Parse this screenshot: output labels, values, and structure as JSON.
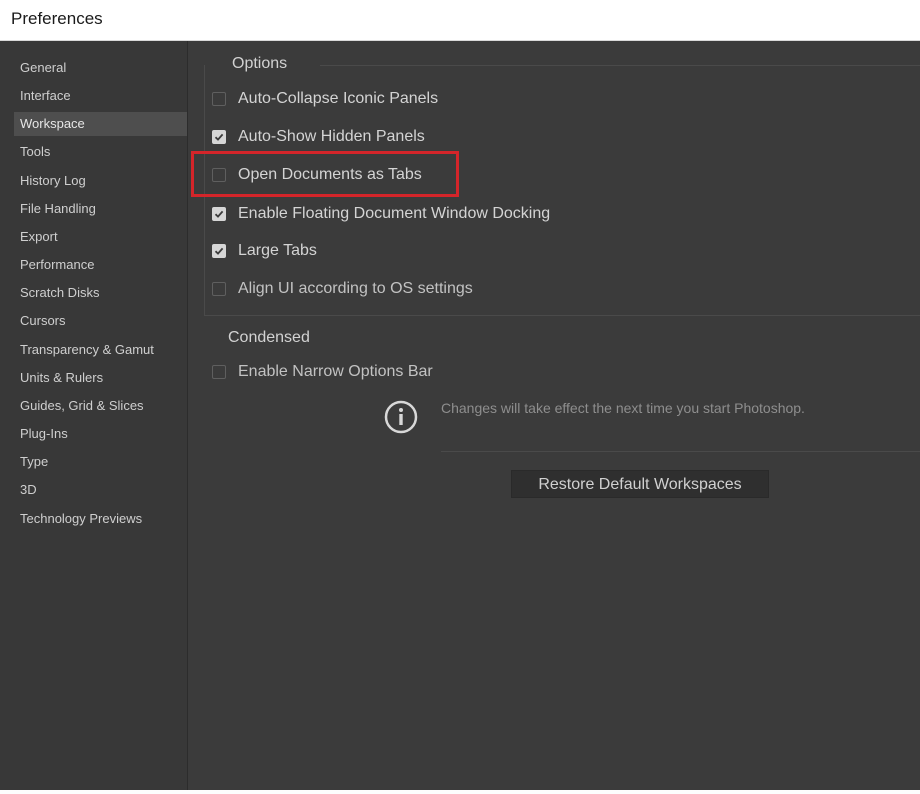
{
  "window": {
    "title": "Preferences"
  },
  "sidebar": {
    "items": [
      {
        "label": "General"
      },
      {
        "label": "Interface"
      },
      {
        "label": "Workspace",
        "selected": true
      },
      {
        "label": "Tools"
      },
      {
        "label": "History Log"
      },
      {
        "label": "File Handling"
      },
      {
        "label": "Export"
      },
      {
        "label": "Performance"
      },
      {
        "label": "Scratch Disks"
      },
      {
        "label": "Cursors"
      },
      {
        "label": "Transparency & Gamut"
      },
      {
        "label": "Units & Rulers"
      },
      {
        "label": "Guides, Grid & Slices"
      },
      {
        "label": "Plug-Ins"
      },
      {
        "label": "Type"
      },
      {
        "label": "3D"
      },
      {
        "label": "Technology Previews"
      }
    ]
  },
  "options": {
    "group_label": "Options",
    "items": [
      {
        "label": "Auto-Collapse Iconic Panels",
        "checked": false
      },
      {
        "label": "Auto-Show Hidden Panels",
        "checked": true
      },
      {
        "label": "Open Documents as Tabs",
        "checked": false,
        "highlighted": true
      },
      {
        "label": "Enable Floating Document Window Docking",
        "checked": true
      },
      {
        "label": "Large Tabs",
        "checked": true
      },
      {
        "label": "Align UI according to OS settings",
        "checked": false
      }
    ]
  },
  "condensed": {
    "group_label": "Condensed",
    "items": [
      {
        "label": "Enable Narrow Options Bar",
        "checked": false
      }
    ]
  },
  "info": {
    "icon": "info-icon",
    "message": "Changes will take effect the next time you start Photoshop."
  },
  "restore_button_label": "Restore Default Workspaces",
  "colors": {
    "highlight_border": "#d4252a",
    "panel_background": "#3b3b3b",
    "selected_item_background": "#4e4e4e"
  }
}
